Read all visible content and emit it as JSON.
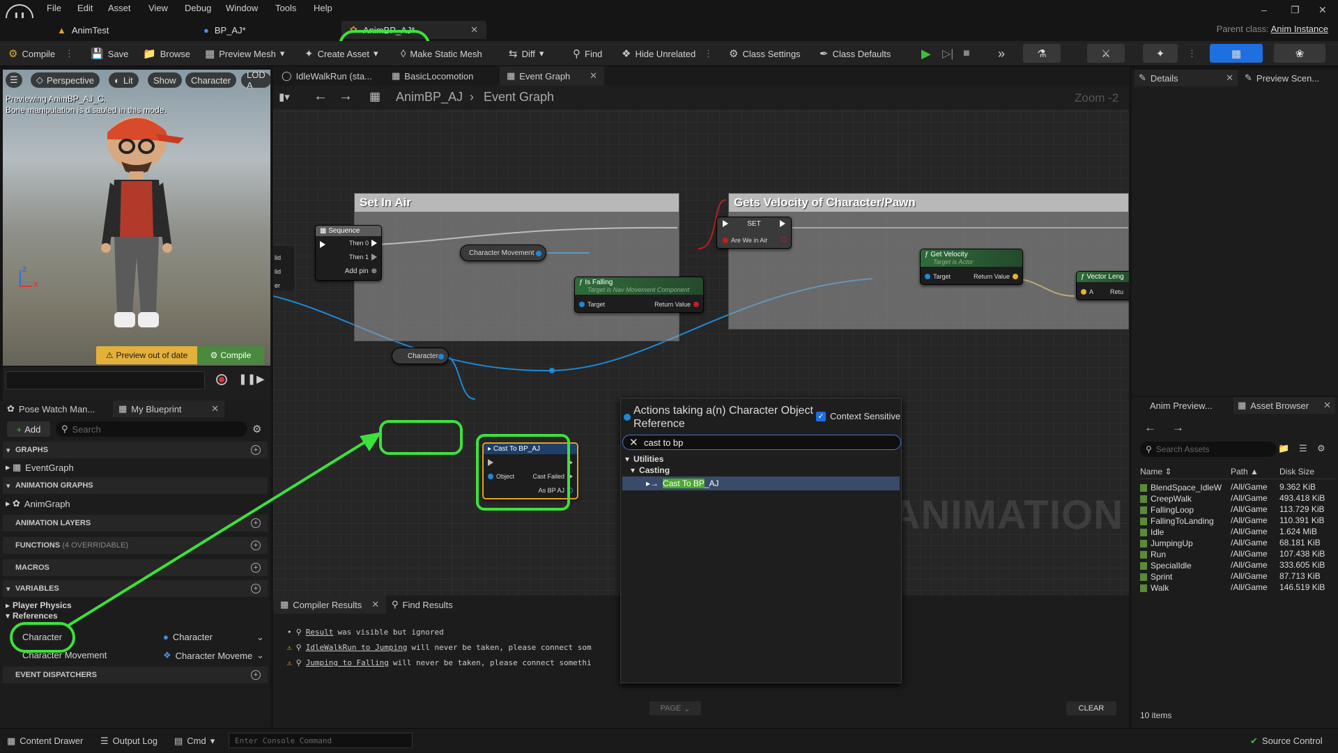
{
  "menubar": {
    "items": [
      "File",
      "Edit",
      "Asset",
      "View",
      "Debug",
      "Window",
      "Tools",
      "Help"
    ]
  },
  "doc_tabs": [
    "AnimTest",
    "BP_AJ*",
    "AnimBP_AJ*"
  ],
  "parent_class": {
    "label": "Parent class:",
    "value": "Anim Instance"
  },
  "toolbar": {
    "compile": "Compile",
    "save": "Save",
    "browse": "Browse",
    "preview_mesh": "Preview Mesh",
    "create_asset": "Create Asset",
    "make_static_mesh": "Make Static Mesh",
    "diff": "Diff",
    "find": "Find",
    "hide_unrelated": "Hide Unrelated",
    "class_settings": "Class Settings",
    "class_defaults": "Class Defaults"
  },
  "viewport": {
    "buttons": [
      "Perspective",
      "Lit",
      "Show",
      "Character",
      "LOD A"
    ],
    "message_line1": "Previewing AnimBP_AJ_C.",
    "message_line2": "Bone manipulation is disabled in this mode.",
    "preview_out_of_date": "Preview out of date",
    "compile": "Compile",
    "axis_z": "Z",
    "axis_x": "X"
  },
  "left_panel": {
    "tabs": [
      "Pose Watch Man...",
      "My Blueprint"
    ],
    "add": "Add",
    "search_placeholder": "Search",
    "sections": {
      "graphs": "GRAPHS",
      "anim_graphs": "ANIMATION GRAPHS",
      "anim_layers": "ANIMATION LAYERS",
      "functions": "FUNCTIONS",
      "functions_note": "(4 OVERRIDABLE)",
      "macros": "MACROS",
      "variables": "VARIABLES",
      "event_dispatchers": "EVENT DISPATCHERS"
    },
    "event_graph": "EventGraph",
    "anim_graph": "AnimGraph",
    "player_physics": "Player Physics",
    "references": "References",
    "vars": [
      {
        "name": "Character",
        "type": "Character"
      },
      {
        "name": "Character Movement",
        "type": "Character Moveme"
      }
    ]
  },
  "graph": {
    "tabs": [
      "IdleWalkRun (sta...",
      "BasicLocomotion",
      "Event Graph"
    ],
    "breadcrumb": [
      "AnimBP_AJ",
      "Event Graph"
    ],
    "zoom": "Zoom -2",
    "comments": [
      "Set In Air",
      "Gets Velocity of Character/Pawn"
    ],
    "sequence": {
      "title": "Sequence",
      "then0": "Then 0",
      "then1": "Then 1",
      "add_pin": "Add pin"
    },
    "set_node": {
      "title": "SET",
      "pin": "Are We in Air"
    },
    "is_falling": {
      "title": "Is Falling",
      "subtitle": "Target is Nav Movement Component",
      "target": "Target",
      "return": "Return Value"
    },
    "char_movement": "Character Movement",
    "get_velocity": {
      "title": "Get Velocity",
      "subtitle": "Target is Actor",
      "target": "Target",
      "return": "Return Value"
    },
    "vector_length": {
      "title": "Vector Leng",
      "a": "A",
      "return": "Retu"
    },
    "character_node": "Character",
    "cast_node": {
      "title": "Cast To BP_AJ",
      "object": "Object",
      "cast_failed": "Cast Failed",
      "as_bp": "As BP AJ"
    },
    "left_pins": [
      "lid",
      "lid",
      "er"
    ],
    "watermark": "ANIMATION"
  },
  "action_menu": {
    "title": "Actions taking a(n) Character Object Reference",
    "context_sensitive": "Context Sensitive",
    "search_value": "cast to bp",
    "category": "Utilities",
    "subcategory": "Casting",
    "result_highlight": "Cast To BP",
    "result_rest": "_AJ"
  },
  "compiler": {
    "tabs": [
      "Compiler Results",
      "Find Results"
    ],
    "lines": [
      {
        "link": "Result",
        "text": " was visible but ignored"
      },
      {
        "link": "IdleWalkRun to Jumping",
        "text": " will never be taken, please connect som"
      },
      {
        "link": "Jumping to Falling",
        "text": " will never be taken, please connect somethi"
      }
    ],
    "page": "PAGE",
    "clear": "CLEAR"
  },
  "details": {
    "tabs": [
      "Details",
      "Preview Scen..."
    ]
  },
  "asset_browser": {
    "tabs": [
      "Anim Preview...",
      "Asset Browser"
    ],
    "search_placeholder": "Search Assets",
    "columns": [
      "Name",
      "Path",
      "Disk Size"
    ],
    "rows": [
      {
        "name": "BlendSpace_IdleW",
        "path": "/All/Game",
        "size": "9.362 KiB"
      },
      {
        "name": "CreepWalk",
        "path": "/All/Game",
        "size": "493.418 KiB"
      },
      {
        "name": "FallingLoop",
        "path": "/All/Game",
        "size": "113.729 KiB"
      },
      {
        "name": "FallingToLanding",
        "path": "/All/Game",
        "size": "110.391 KiB"
      },
      {
        "name": "Idle",
        "path": "/All/Game",
        "size": "1.624 MiB"
      },
      {
        "name": "JumpingUp",
        "path": "/All/Game",
        "size": "68.181 KiB"
      },
      {
        "name": "Run",
        "path": "/All/Game",
        "size": "107.438 KiB"
      },
      {
        "name": "SpecialIdle",
        "path": "/All/Game",
        "size": "333.605 KiB"
      },
      {
        "name": "Sprint",
        "path": "/All/Game",
        "size": "87.713 KiB"
      },
      {
        "name": "Walk",
        "path": "/All/Game",
        "size": "146.519 KiB"
      }
    ],
    "count": "10 items"
  },
  "statusbar": {
    "content_drawer": "Content Drawer",
    "output_log": "Output Log",
    "cmd": "Cmd",
    "console_placeholder": "Enter Console Command",
    "source_control": "Source Control"
  },
  "colors": {
    "highlight": "#3be23b",
    "accent": "#1e6fe0",
    "play": "#3fbf3f"
  }
}
